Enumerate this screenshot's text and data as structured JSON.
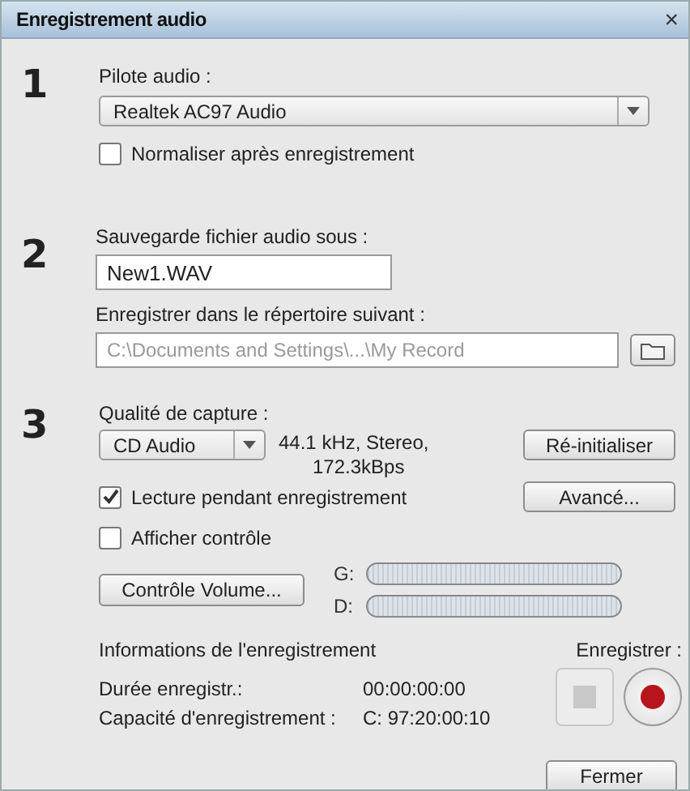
{
  "window": {
    "title": "Enregistrement audio",
    "close": "×"
  },
  "step1": {
    "number": "1",
    "label": "Pilote audio :",
    "driver": {
      "value": "Realtek AC97 Audio"
    },
    "normalize": {
      "label": "Normaliser après enregistrement",
      "checked": false
    }
  },
  "step2": {
    "number": "2",
    "file_label": "Sauvegarde fichier audio sous :",
    "file_name": {
      "value": "New1.WAV"
    },
    "folder_label": "Enregistrer dans le répertoire suivant :",
    "folder": {
      "value": "C:\\Documents and Settings\\...\\My Record",
      "disabled": true
    }
  },
  "step3": {
    "number": "3",
    "label": "Qualité de capture :",
    "quality": {
      "value": "CD Audio"
    },
    "format_lines": [
      "44.1 kHz, Stereo,",
      "172.3kBps"
    ],
    "reset_button": "Ré-initialiser",
    "playback": {
      "label": "Lecture pendant enregistrement",
      "checked": true
    },
    "advanced_button": "Avancé...",
    "show_control": {
      "label": "Afficher contrôle",
      "checked": false
    },
    "volume_button": "Contrôle Volume...",
    "meters": [
      {
        "label": "G:",
        "level": 0
      },
      {
        "label": "D:",
        "level": 0
      }
    ]
  },
  "info": {
    "title": "Informations de l'enregistrement",
    "rows": [
      {
        "label": "Durée enregistr.:",
        "value": "00:00:00:00"
      },
      {
        "label": "Capacité d'enregistrement :",
        "value": "C: 97:20:00:10"
      }
    ]
  },
  "record": {
    "label": "Enregistrer :",
    "stop_disabled": true
  },
  "close_button": "Fermer"
}
